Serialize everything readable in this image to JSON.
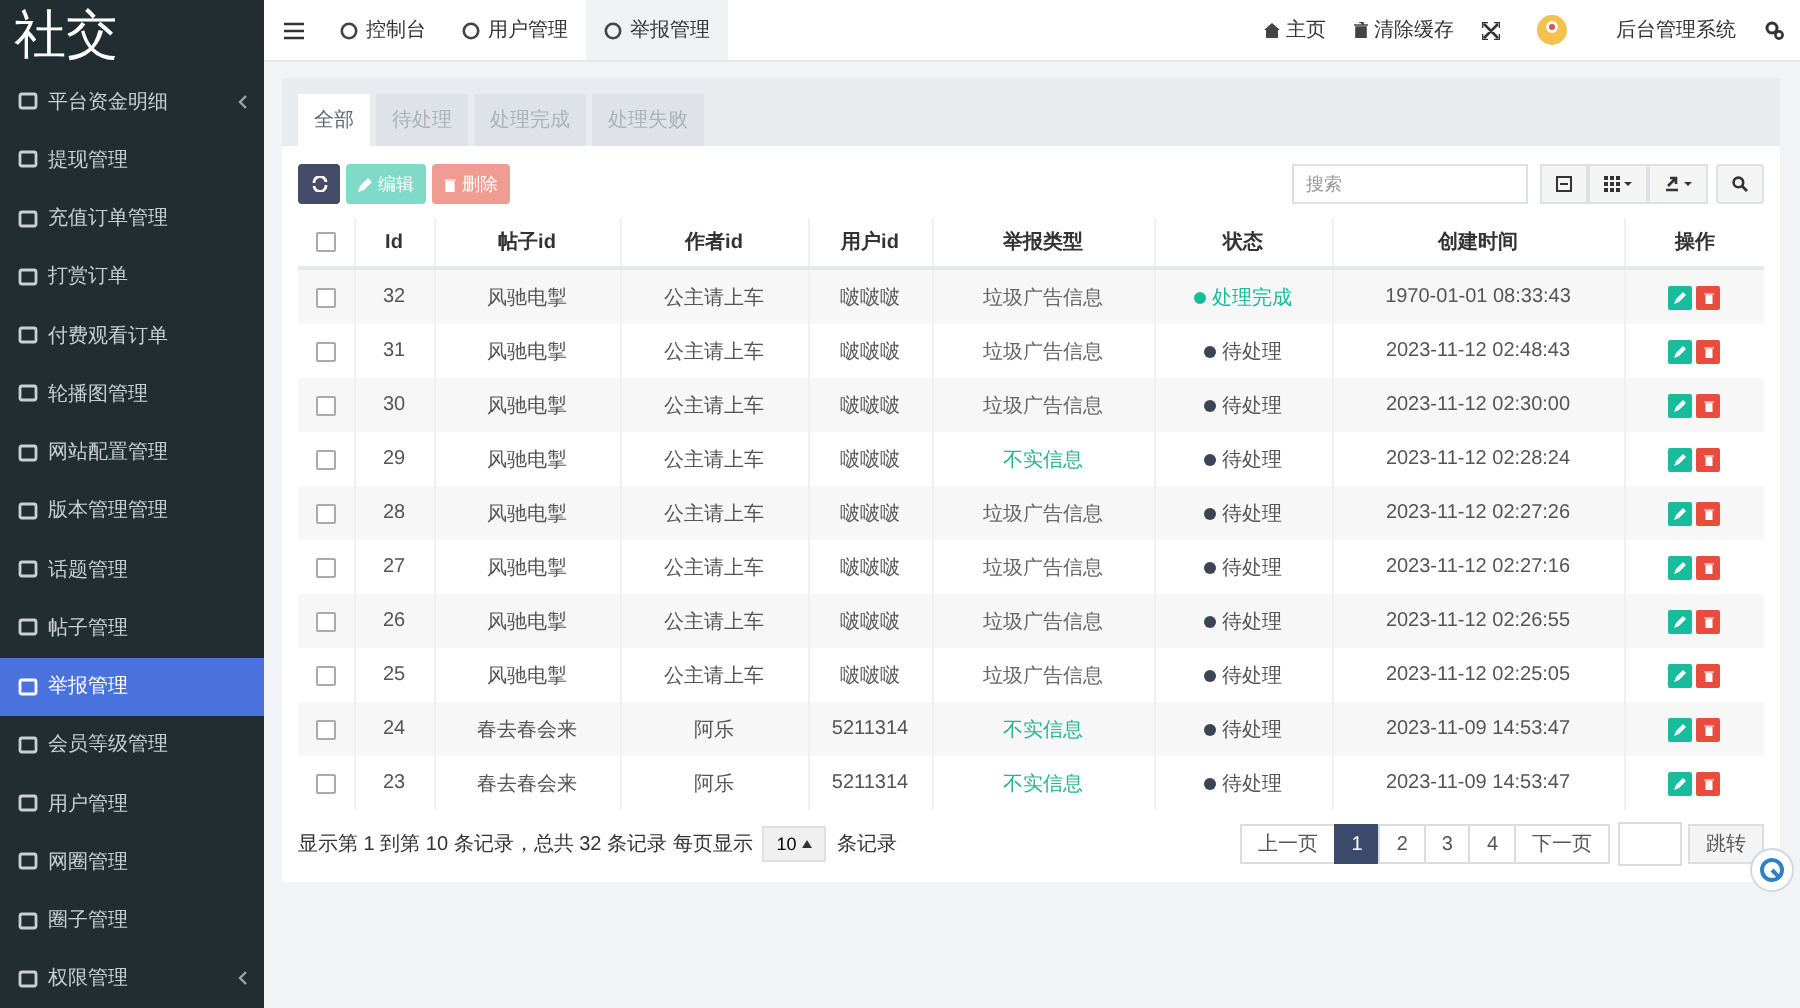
{
  "logo": "社交",
  "sidebar": {
    "items": [
      {
        "label": "平台资金明细",
        "expandable": true,
        "selected": false
      },
      {
        "label": "提现管理",
        "expandable": false,
        "selected": false
      },
      {
        "label": "充值订单管理",
        "expandable": false,
        "selected": false
      },
      {
        "label": "打赏订单",
        "expandable": false,
        "selected": false
      },
      {
        "label": "付费观看订单",
        "expandable": false,
        "selected": false
      },
      {
        "label": "轮播图管理",
        "expandable": false,
        "selected": false
      },
      {
        "label": "网站配置管理",
        "expandable": false,
        "selected": false
      },
      {
        "label": "版本管理管理",
        "expandable": false,
        "selected": false
      },
      {
        "label": "话题管理",
        "expandable": false,
        "selected": false
      },
      {
        "label": "帖子管理",
        "expandable": false,
        "selected": false
      },
      {
        "label": "举报管理",
        "expandable": false,
        "selected": true
      },
      {
        "label": "会员等级管理",
        "expandable": false,
        "selected": false
      },
      {
        "label": "用户管理",
        "expandable": false,
        "selected": false
      },
      {
        "label": "网圈管理",
        "expandable": false,
        "selected": false
      },
      {
        "label": "圈子管理",
        "expandable": false,
        "selected": false
      },
      {
        "label": "权限管理",
        "expandable": true,
        "selected": false
      }
    ]
  },
  "topbar": {
    "tabs": [
      {
        "label": "控制台",
        "selected": false
      },
      {
        "label": "用户管理",
        "selected": false
      },
      {
        "label": "举报管理",
        "selected": true
      }
    ],
    "links": [
      {
        "label": "主页",
        "kind": "home"
      },
      {
        "label": "清除缓存",
        "kind": "trash"
      }
    ],
    "system_name": "后台管理系统"
  },
  "filter_tabs": [
    {
      "label": "全部",
      "selected": true
    },
    {
      "label": "待处理",
      "selected": false
    },
    {
      "label": "处理完成",
      "selected": false
    },
    {
      "label": "处理失败",
      "selected": false
    }
  ],
  "toolbar": {
    "buttons": [
      {
        "label": "编辑",
        "kind": "edit",
        "disabled": true
      },
      {
        "label": "删除",
        "kind": "delete",
        "disabled": true
      }
    ],
    "search": {
      "placeholder": "搜索"
    }
  },
  "table": {
    "select_all": {
      "checked": false
    },
    "columns": [
      "Id",
      "帖子id",
      "作者id",
      "用户id",
      "举报类型",
      "状态",
      "创建时间",
      "操作"
    ],
    "rows": [
      {
        "checked": false,
        "id": "32",
        "post": "风驰电掣",
        "author": "公主请上车",
        "user": "啵啵啵",
        "type": {
          "label": "垃圾广告信息",
          "kind": "spam"
        },
        "status": {
          "label": "处理完成",
          "kind": "done"
        },
        "created": "1970-01-01 08:33:43"
      },
      {
        "checked": false,
        "id": "31",
        "post": "风驰电掣",
        "author": "公主请上车",
        "user": "啵啵啵",
        "type": {
          "label": "垃圾广告信息",
          "kind": "spam"
        },
        "status": {
          "label": "待处理",
          "kind": "pending"
        },
        "created": "2023-11-12 02:48:43"
      },
      {
        "checked": false,
        "id": "30",
        "post": "风驰电掣",
        "author": "公主请上车",
        "user": "啵啵啵",
        "type": {
          "label": "垃圾广告信息",
          "kind": "spam"
        },
        "status": {
          "label": "待处理",
          "kind": "pending"
        },
        "created": "2023-11-12 02:30:00"
      },
      {
        "checked": false,
        "id": "29",
        "post": "风驰电掣",
        "author": "公主请上车",
        "user": "啵啵啵",
        "type": {
          "label": "不实信息",
          "kind": "false"
        },
        "status": {
          "label": "待处理",
          "kind": "pending"
        },
        "created": "2023-11-12 02:28:24"
      },
      {
        "checked": false,
        "id": "28",
        "post": "风驰电掣",
        "author": "公主请上车",
        "user": "啵啵啵",
        "type": {
          "label": "垃圾广告信息",
          "kind": "spam"
        },
        "status": {
          "label": "待处理",
          "kind": "pending"
        },
        "created": "2023-11-12 02:27:26"
      },
      {
        "checked": false,
        "id": "27",
        "post": "风驰电掣",
        "author": "公主请上车",
        "user": "啵啵啵",
        "type": {
          "label": "垃圾广告信息",
          "kind": "spam"
        },
        "status": {
          "label": "待处理",
          "kind": "pending"
        },
        "created": "2023-11-12 02:27:16"
      },
      {
        "checked": false,
        "id": "26",
        "post": "风驰电掣",
        "author": "公主请上车",
        "user": "啵啵啵",
        "type": {
          "label": "垃圾广告信息",
          "kind": "spam"
        },
        "status": {
          "label": "待处理",
          "kind": "pending"
        },
        "created": "2023-11-12 02:26:55"
      },
      {
        "checked": false,
        "id": "25",
        "post": "风驰电掣",
        "author": "公主请上车",
        "user": "啵啵啵",
        "type": {
          "label": "垃圾广告信息",
          "kind": "spam"
        },
        "status": {
          "label": "待处理",
          "kind": "pending"
        },
        "created": "2023-11-12 02:25:05"
      },
      {
        "checked": false,
        "id": "24",
        "post": "春去春会来",
        "author": "阿乐",
        "user": "5211314",
        "type": {
          "label": "不实信息",
          "kind": "false"
        },
        "status": {
          "label": "待处理",
          "kind": "pending"
        },
        "created": "2023-11-09 14:53:47"
      },
      {
        "checked": false,
        "id": "23",
        "post": "春去春会来",
        "author": "阿乐",
        "user": "5211314",
        "type": {
          "label": "不实信息",
          "kind": "false"
        },
        "status": {
          "label": "待处理",
          "kind": "pending"
        },
        "created": "2023-11-09 14:53:47"
      }
    ]
  },
  "footer": {
    "summary": "显示第 1 到第 10 条记录，总共 32 条记录 每页显示",
    "page_size": "10",
    "page_size_suffix": "条记录",
    "pagination": {
      "prev": "上一页",
      "pages": [
        {
          "label": "1",
          "selected": true
        },
        {
          "label": "2",
          "selected": false
        },
        {
          "label": "3",
          "selected": false
        },
        {
          "label": "4",
          "selected": false
        }
      ],
      "next": "下一页",
      "jump": "跳转"
    }
  }
}
